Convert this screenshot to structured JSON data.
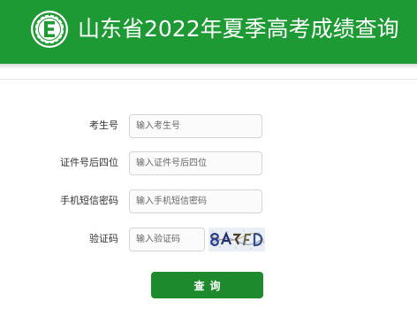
{
  "header": {
    "title": "山东省2022年夏季高考成绩查询",
    "logo_icon": "exam-authority-seal-logo",
    "background_color": "#1e9a35"
  },
  "form": {
    "fields": [
      {
        "label": "考生号",
        "placeholder": "输入考生号",
        "value": ""
      },
      {
        "label": "证件号后四位",
        "placeholder": "输入证件号后四位",
        "value": ""
      },
      {
        "label": "手机短信密码",
        "placeholder": "输入手机短信密码",
        "value": ""
      },
      {
        "label": "验证码",
        "placeholder": "输入验证码",
        "value": ""
      }
    ],
    "captcha_image": "captcha-image",
    "submit_label": "查询",
    "submit_color": "#1e8a2e"
  }
}
